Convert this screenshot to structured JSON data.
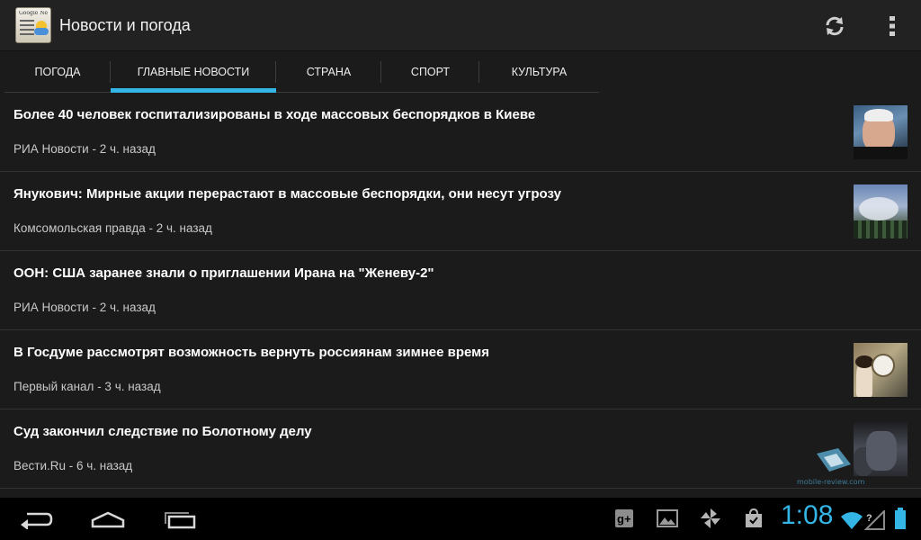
{
  "app": {
    "title": "Новости и погода",
    "icon_name": "google-news-weather-icon",
    "icon_masthead": "Google News"
  },
  "toolbar": {
    "refresh_icon": "refresh-icon",
    "overflow_icon": "overflow-menu-icon"
  },
  "tabs": [
    {
      "label": "ПОГОДА",
      "active": false
    },
    {
      "label": "ГЛАВНЫЕ НОВОСТИ",
      "active": true
    },
    {
      "label": "СТРАНА",
      "active": false
    },
    {
      "label": "СПОРТ",
      "active": false
    },
    {
      "label": "КУЛЬТУРА",
      "active": false
    }
  ],
  "news": [
    {
      "headline": "Более 40 человек госпитализированы в ходе массовых беспорядков в Киеве",
      "source": "РИА Новости - 2 ч. назад",
      "has_thumbnail": true
    },
    {
      "headline": "Янукович: Мирные акции перерастают в массовые беспорядки, они несут угрозу",
      "source": "Комсомольская правда - 2 ч. назад",
      "has_thumbnail": true
    },
    {
      "headline": "ООН: США заранее знали о приглашении Ирана на \"Женеву-2\"",
      "source": "РИА Новости - 2 ч. назад",
      "has_thumbnail": false
    },
    {
      "headline": "В Госдуме рассмотрят возможность вернуть россиянам зимнее время",
      "source": "Первый канал - 3 ч. назад",
      "has_thumbnail": true
    },
    {
      "headline": "Суд закончил следствие по Болотному делу",
      "source": "Вести.Ru - 6 ч. назад",
      "has_thumbnail": true
    }
  ],
  "watermark": {
    "text": "mobile-review.com"
  },
  "system_bar": {
    "clock": "1:08",
    "accent_color": "#33b5e5",
    "nav_icons": [
      "back-icon",
      "home-icon",
      "recent-apps-icon"
    ],
    "notification_icons": [
      "google-plus-icon",
      "gallery-icon",
      "pinwheel-icon",
      "shopping-bag-icon"
    ],
    "status_icons": [
      "wifi-icon",
      "signal-icon",
      "battery-icon"
    ]
  }
}
